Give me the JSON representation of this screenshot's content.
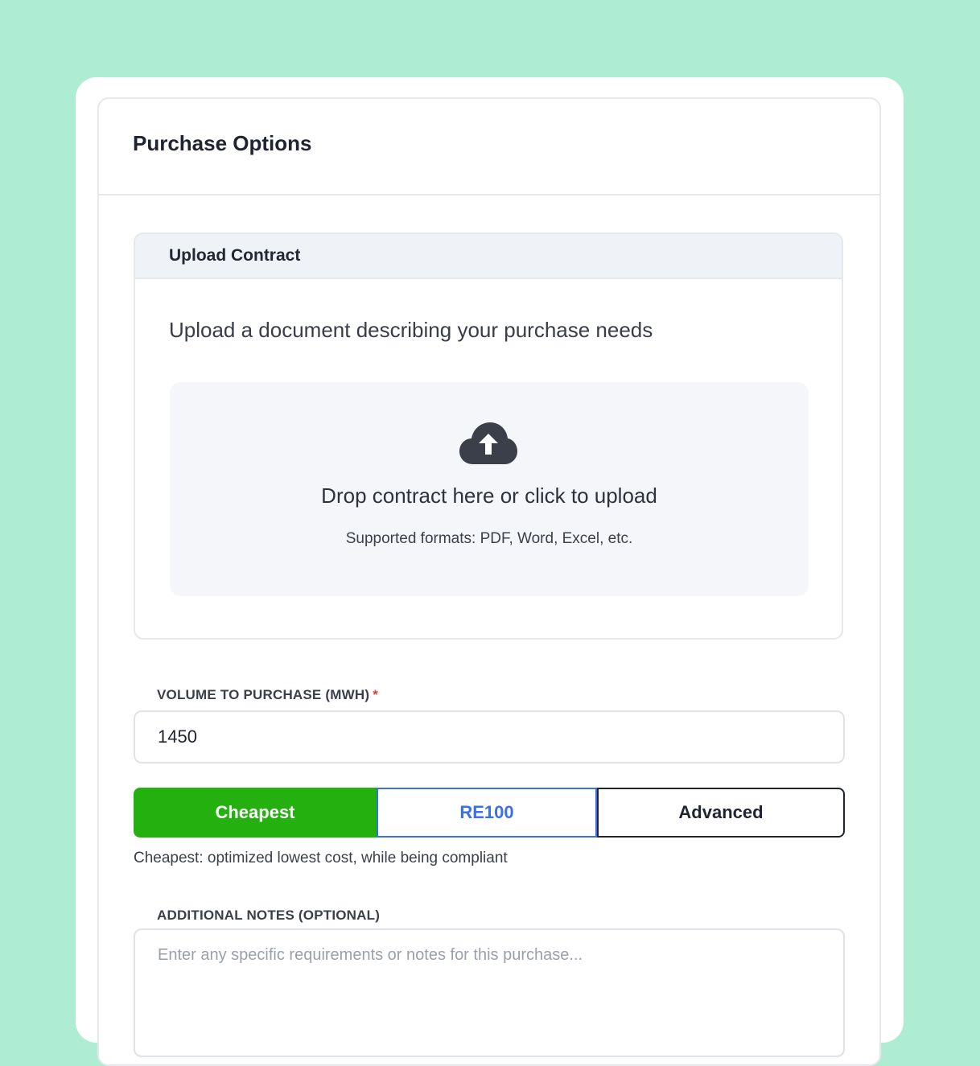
{
  "card": {
    "title": "Purchase Options"
  },
  "upload": {
    "header": "Upload Contract",
    "description": "Upload a document describing your purchase needs",
    "dropzone": {
      "icon": "cloud-upload-icon",
      "main_text": "Drop contract here or click to upload",
      "sub_text": "Supported formats: PDF, Word, Excel, etc."
    }
  },
  "volume": {
    "label": "VOLUME TO PURCHASE (MWH)",
    "required_mark": "*",
    "value": "1450"
  },
  "mode": {
    "options": [
      {
        "label": "Cheapest",
        "selected": true
      },
      {
        "label": "RE100",
        "selected": false
      },
      {
        "label": "Advanced",
        "selected": false
      }
    ],
    "description": "Cheapest: optimized lowest cost, while being compliant"
  },
  "notes": {
    "label": "ADDITIONAL NOTES (OPTIONAL)",
    "placeholder": "Enter any specific requirements or notes for this purchase...",
    "value": ""
  },
  "colors": {
    "background": "#aeecd4",
    "selected_green": "#24b10f",
    "re100_blue": "#3a6ff0",
    "required_red": "#e23b3b"
  }
}
